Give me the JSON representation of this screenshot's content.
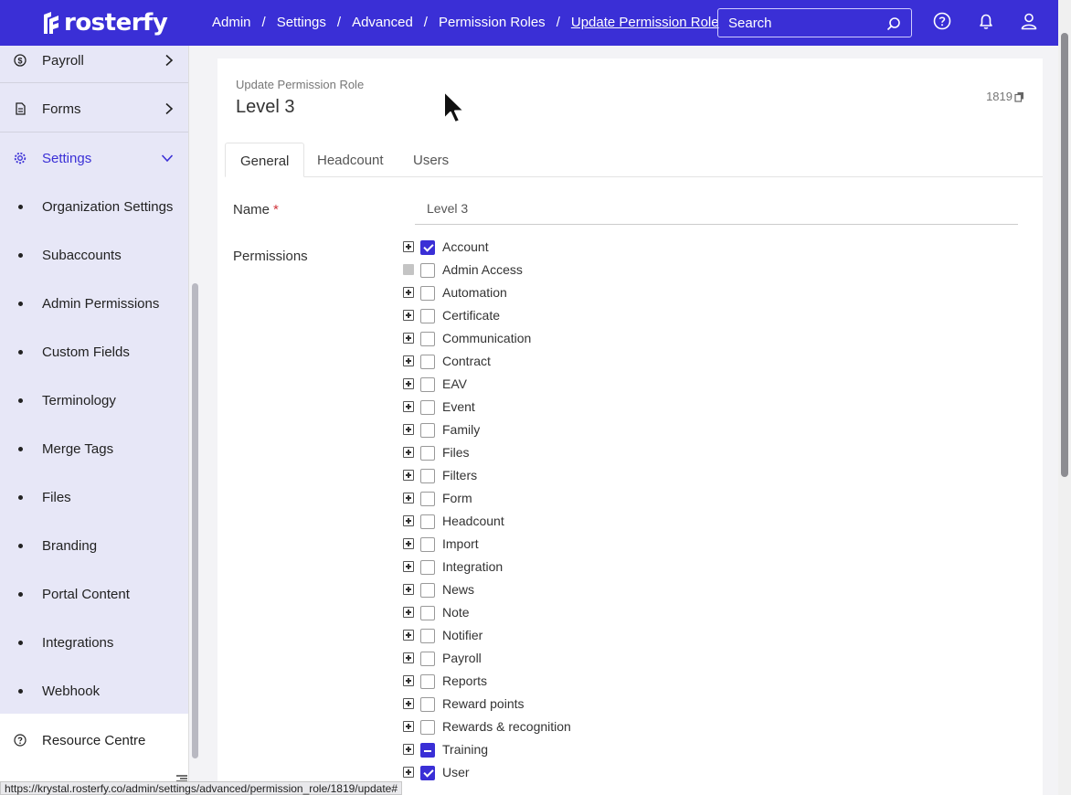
{
  "header": {
    "brand": "rosterfy",
    "breadcrumbs": [
      {
        "label": "Admin"
      },
      {
        "label": "Settings"
      },
      {
        "label": "Advanced"
      },
      {
        "label": "Permission Roles"
      },
      {
        "label": "Update Permission Role"
      }
    ],
    "breadcrumb_separator": "/",
    "search_placeholder": "Search",
    "icons": [
      "help-icon",
      "bell-icon",
      "user-icon"
    ],
    "brand_color": "#3a2fd6"
  },
  "sidebar": {
    "items": [
      {
        "label": "Payroll",
        "icon": "dollar-icon"
      },
      {
        "label": "Forms",
        "icon": "document-icon"
      },
      {
        "label": "Settings",
        "icon": "gear-icon",
        "active": true
      }
    ],
    "sub_items": [
      {
        "label": "Organization Settings"
      },
      {
        "label": "Subaccounts"
      },
      {
        "label": "Admin Permissions"
      },
      {
        "label": "Custom Fields"
      },
      {
        "label": "Terminology"
      },
      {
        "label": "Merge Tags"
      },
      {
        "label": "Files"
      },
      {
        "label": "Branding"
      },
      {
        "label": "Portal Content"
      },
      {
        "label": "Integrations"
      },
      {
        "label": "Webhook"
      }
    ],
    "footer_item": {
      "label": "Resource Centre",
      "icon": "help-icon"
    }
  },
  "main": {
    "subtitle": "Update Permission Role",
    "title": "Level 3",
    "record_id": "1819",
    "tabs": [
      {
        "label": "General",
        "active": true
      },
      {
        "label": "Headcount"
      },
      {
        "label": "Users"
      }
    ],
    "name_label": "Name",
    "required_mark": "*",
    "name_value": "Level 3",
    "permissions_label": "Permissions",
    "permissions": [
      {
        "label": "Account",
        "state": "checked",
        "expandable": true
      },
      {
        "label": "Admin Access",
        "state": "unchecked",
        "expandable": false
      },
      {
        "label": "Automation",
        "state": "unchecked",
        "expandable": true
      },
      {
        "label": "Certificate",
        "state": "unchecked",
        "expandable": true
      },
      {
        "label": "Communication",
        "state": "unchecked",
        "expandable": true
      },
      {
        "label": "Contract",
        "state": "unchecked",
        "expandable": true
      },
      {
        "label": "EAV",
        "state": "unchecked",
        "expandable": true
      },
      {
        "label": "Event",
        "state": "unchecked",
        "expandable": true
      },
      {
        "label": "Family",
        "state": "unchecked",
        "expandable": true
      },
      {
        "label": "Files",
        "state": "unchecked",
        "expandable": true
      },
      {
        "label": "Filters",
        "state": "unchecked",
        "expandable": true
      },
      {
        "label": "Form",
        "state": "unchecked",
        "expandable": true
      },
      {
        "label": "Headcount",
        "state": "unchecked",
        "expandable": true
      },
      {
        "label": "Import",
        "state": "unchecked",
        "expandable": true
      },
      {
        "label": "Integration",
        "state": "unchecked",
        "expandable": true
      },
      {
        "label": "News",
        "state": "unchecked",
        "expandable": true
      },
      {
        "label": "Note",
        "state": "unchecked",
        "expandable": true
      },
      {
        "label": "Notifier",
        "state": "unchecked",
        "expandable": true
      },
      {
        "label": "Payroll",
        "state": "unchecked",
        "expandable": true
      },
      {
        "label": "Reports",
        "state": "unchecked",
        "expandable": true
      },
      {
        "label": "Reward points",
        "state": "unchecked",
        "expandable": true
      },
      {
        "label": "Rewards & recognition",
        "state": "unchecked",
        "expandable": true
      },
      {
        "label": "Training",
        "state": "partial",
        "expandable": true
      },
      {
        "label": "User",
        "state": "checked",
        "expandable": true
      }
    ]
  },
  "status_bar": {
    "url": "https://krystal.rosterfy.co/admin/settings/advanced/permission_role/1819/update#"
  }
}
